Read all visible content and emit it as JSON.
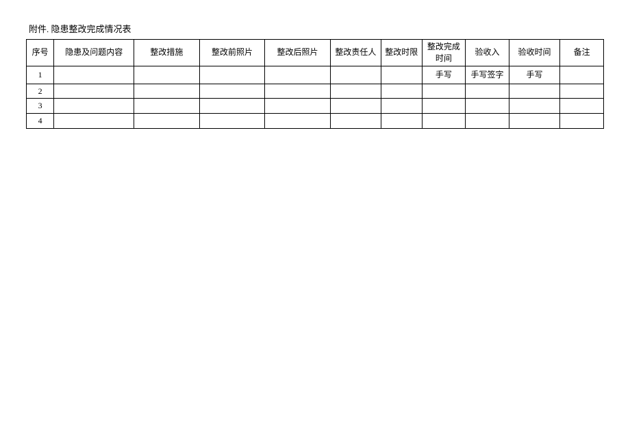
{
  "title": "附件. 隐患整改完成情况表",
  "headers": {
    "seq": "序号",
    "issue": "隐患及问题内容",
    "measure": "整改措施",
    "photo_before": "整改前照片",
    "photo_after": "整改后照片",
    "responsible": "整改责任人",
    "time_limit": "整改时限",
    "complete_time": "整改完成时间",
    "accept_by": "验收入",
    "accept_time": "验收时间",
    "remark": "备注"
  },
  "rows": [
    {
      "seq": "1",
      "issue": "",
      "measure": "",
      "photo_before": "",
      "photo_after": "",
      "responsible": "",
      "time_limit": "",
      "complete_time": "手写",
      "accept_by": "手写签字",
      "accept_time": "手写",
      "remark": ""
    },
    {
      "seq": "2",
      "issue": "",
      "measure": "",
      "photo_before": "",
      "photo_after": "",
      "responsible": "",
      "time_limit": "",
      "complete_time": "",
      "accept_by": "",
      "accept_time": "",
      "remark": ""
    },
    {
      "seq": "3",
      "issue": "",
      "measure": "",
      "photo_before": "",
      "photo_after": "",
      "responsible": "",
      "time_limit": "",
      "complete_time": "",
      "accept_by": "",
      "accept_time": "",
      "remark": ""
    },
    {
      "seq": "4",
      "issue": "",
      "measure": "",
      "photo_before": "",
      "photo_after": "",
      "responsible": "",
      "time_limit": "",
      "complete_time": "",
      "accept_by": "",
      "accept_time": "",
      "remark": ""
    }
  ]
}
